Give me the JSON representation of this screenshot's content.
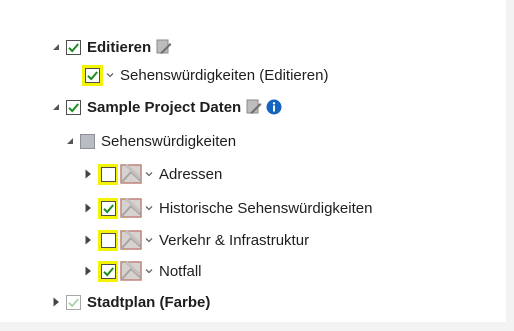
{
  "tree": {
    "editieren": {
      "label": "Editieren",
      "checked": true
    },
    "sehens_edit": {
      "label": "Sehenswürdigkeiten (Editieren)",
      "checked": true
    },
    "sample_project": {
      "label": "Sample Project Daten",
      "checked": true
    },
    "sehens_group": {
      "label": "Sehenswürdigkeiten",
      "checked": "partial"
    },
    "adressen": {
      "label": "Adressen",
      "checked": false
    },
    "historische": {
      "label": "Historische Sehenswürdigkeiten",
      "checked": true
    },
    "verkehr": {
      "label": "Verkehr & Infrastruktur",
      "checked": false
    },
    "notfall": {
      "label": "Notfall",
      "checked": true
    },
    "stadtplan": {
      "label": "Stadtplan (Farbe)",
      "checked": true
    }
  },
  "colors": {
    "highlight": "#f4f400",
    "check": "#1e8c1e",
    "info": "#1565c0"
  },
  "icons": [
    "expanded-arrow-icon",
    "collapsed-arrow-icon",
    "checkbox-icon",
    "edit-pencil-icon",
    "info-icon",
    "layer-icon",
    "chevron-down-icon"
  ]
}
